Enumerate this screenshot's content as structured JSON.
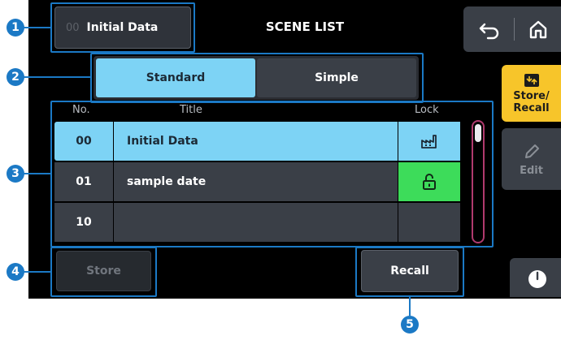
{
  "header": {
    "scene_number": "00",
    "scene_name": "Initial Data",
    "title": "SCENE LIST"
  },
  "tabs": [
    {
      "label": "Standard",
      "selected": true
    },
    {
      "label": "Simple",
      "selected": false
    }
  ],
  "table": {
    "columns": {
      "no": "No.",
      "title": "Title",
      "lock": "Lock"
    },
    "rows": [
      {
        "no": "00",
        "title": "Initial Data",
        "lock": "factory-icon",
        "selected": true
      },
      {
        "no": "01",
        "title": "sample date",
        "lock": "lock-icon",
        "selected": false
      },
      {
        "no": "10",
        "title": "",
        "lock": "",
        "selected": false
      }
    ]
  },
  "actions": {
    "store_label": "Store",
    "recall_label": "Recall"
  },
  "sidebar": {
    "store_recall_line1": "Store/",
    "store_recall_line2": "Recall",
    "edit_label": "Edit"
  },
  "callouts": [
    "1",
    "2",
    "3",
    "4",
    "5"
  ],
  "colors": {
    "accent": "#7dd3f5",
    "lock_green": "#3ddc5a",
    "store_recall_bg": "#f7c52a",
    "callout_blue": "#1b79c5",
    "scrollbar": "#b03a6e"
  }
}
